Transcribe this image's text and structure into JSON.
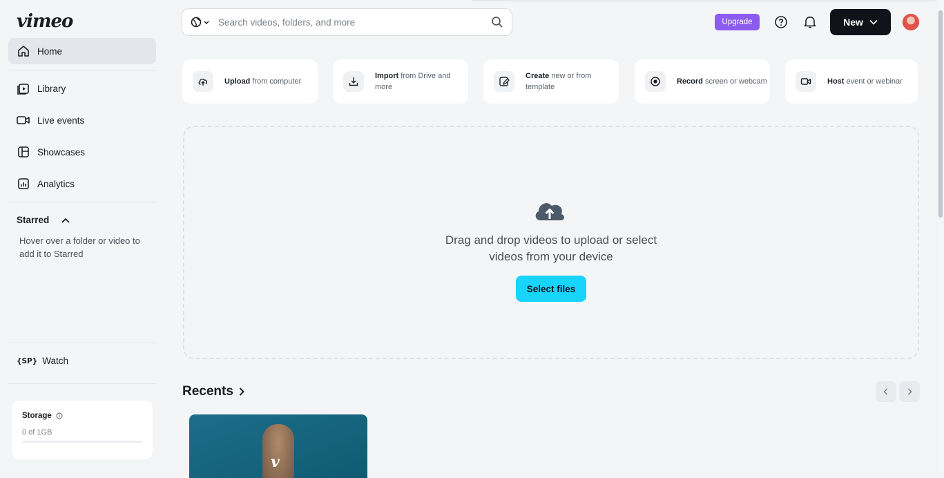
{
  "app": {
    "logo": "vimeo"
  },
  "search": {
    "placeholder": "Search videos, folders, and more"
  },
  "header": {
    "upgrade_label": "Upgrade",
    "new_label": "New"
  },
  "sidebar": {
    "items": [
      {
        "label": "Home",
        "icon": "home-icon",
        "active": true
      },
      {
        "label": "Library",
        "icon": "library-icon"
      },
      {
        "label": "Live events",
        "icon": "live-events-icon"
      },
      {
        "label": "Showcases",
        "icon": "showcases-icon"
      },
      {
        "label": "Analytics",
        "icon": "analytics-icon"
      }
    ],
    "starred": {
      "title": "Starred",
      "hint": "Hover over a folder or video to add it to Starred"
    },
    "watch": {
      "icon_text": "{SP}",
      "label": "Watch"
    },
    "storage": {
      "title": "Storage",
      "used": "0 of 1GB",
      "fraction": 0
    }
  },
  "actions": [
    {
      "bold": "Upload",
      "rest": " from computer",
      "icon": "upload-icon"
    },
    {
      "bold": "Import",
      "rest": " from Drive and more",
      "icon": "import-icon"
    },
    {
      "bold": "Create",
      "rest": " new or from template",
      "icon": "create-icon"
    },
    {
      "bold": "Record",
      "rest": " screen or webcam",
      "icon": "record-icon"
    },
    {
      "bold": "Host",
      "rest": " event or webinar",
      "icon": "host-icon"
    }
  ],
  "dropzone": {
    "line1": "Drag and drop videos to upload or select",
    "line2": "videos from your device",
    "button": "Select files"
  },
  "recents": {
    "title": "Recents",
    "thumb_mark": "v"
  },
  "colors": {
    "accent": "#17d5ff",
    "upgrade": "#8c5cf0",
    "new_button": "#10141a"
  }
}
